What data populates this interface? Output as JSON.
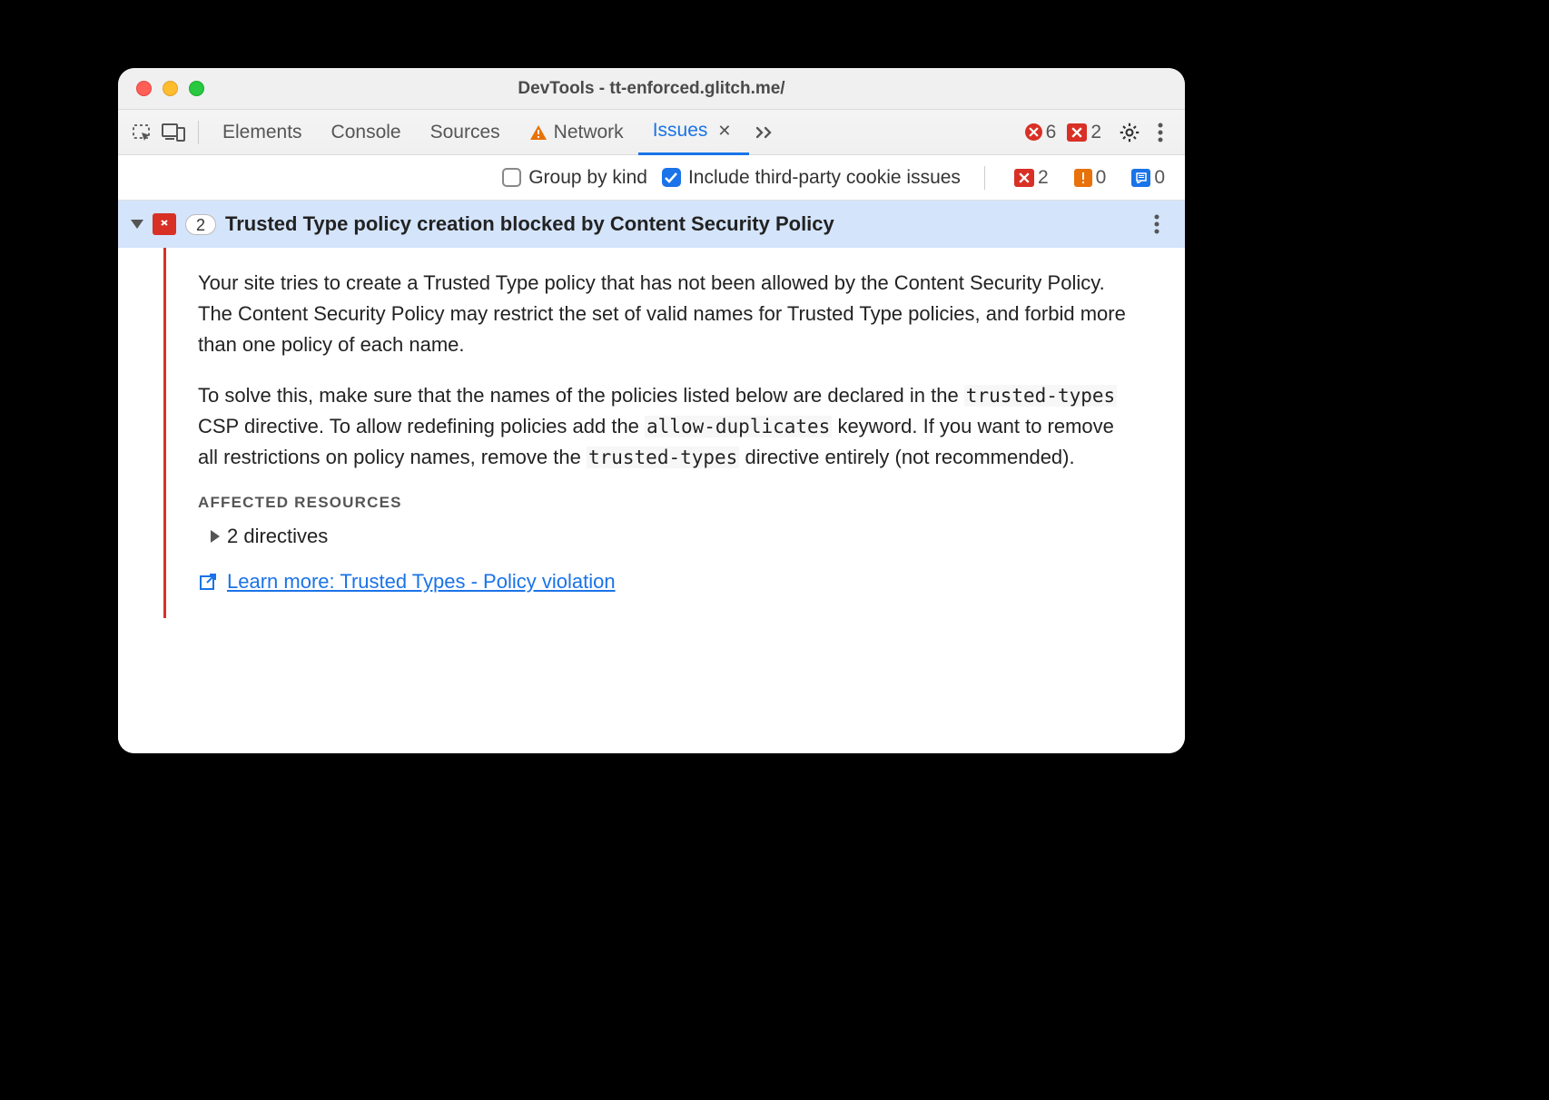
{
  "window_title": "DevTools - tt-enforced.glitch.me/",
  "tabs": {
    "elements": "Elements",
    "console": "Console",
    "sources": "Sources",
    "network": "Network",
    "issues": "Issues"
  },
  "error_count": "6",
  "badge_count": "2",
  "toolbar": {
    "group_by_kind": "Group by kind",
    "include_third_party": "Include third-party cookie issues",
    "red_count": "2",
    "orange_count": "0",
    "blue_count": "0"
  },
  "issue": {
    "count": "2",
    "title": "Trusted Type policy creation blocked by Content Security Policy",
    "para1": "Your site tries to create a Trusted Type policy that has not been allowed by the Content Security Policy. The Content Security Policy may restrict the set of valid names for Trusted Type policies, and forbid more than one policy of each name.",
    "para2_a": "To solve this, make sure that the names of the policies listed below are declared in the ",
    "code1": "trusted-types",
    "para2_b": " CSP directive. To allow redefining policies add the ",
    "code2": "allow-duplicates",
    "para2_c": " keyword. If you want to remove all restrictions on policy names, remove the ",
    "code3": "trusted-types",
    "para2_d": " directive entirely (not recommended).",
    "affected_label": "AFFECTED RESOURCES",
    "directives": "2 directives",
    "learn_more": "Learn more: Trusted Types - Policy violation"
  }
}
